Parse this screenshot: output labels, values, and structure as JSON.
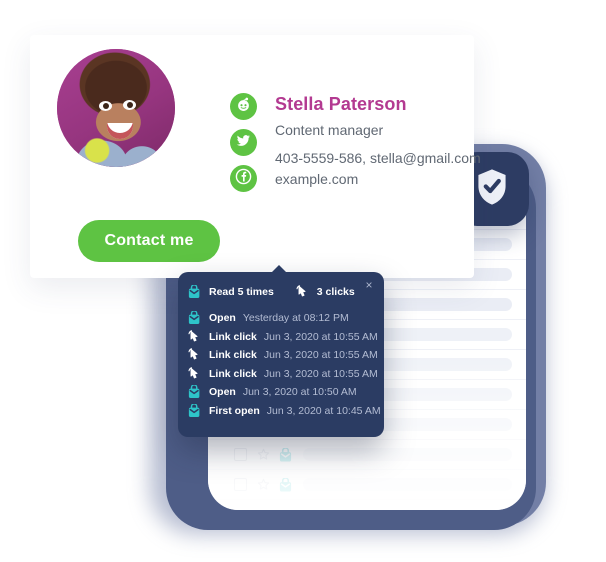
{
  "theme": {
    "brand_green": "#5ec343",
    "name_magenta": "#b33a91",
    "tooltip_navy": "#2b3c63",
    "accent_teal": "#2ec4c9",
    "card_slate": "#4e5d87"
  },
  "profile": {
    "avatar_alt": "Stella Paterson profile photo",
    "name": "Stella Paterson",
    "role": "Content manager",
    "contact_line1": "403-5559-586, stella@gmail.com",
    "contact_line2": "example.com",
    "contact_button": "Contact me",
    "socials": [
      {
        "name": "reddit",
        "icon": "reddit-icon"
      },
      {
        "name": "twitter",
        "icon": "twitter-icon"
      },
      {
        "name": "facebook",
        "icon": "facebook-icon"
      }
    ]
  },
  "badge": {
    "icon": "shield-check-icon"
  },
  "mail_list": {
    "rows": [
      {
        "checkbox_icon": "checkbox-icon",
        "star_icon": "star-icon",
        "tracking_icon": "tracked-envelope-icon"
      },
      {
        "checkbox_icon": "checkbox-icon",
        "star_icon": "star-icon",
        "tracking_icon": "tracked-envelope-icon"
      },
      {
        "checkbox_icon": "checkbox-icon",
        "star_icon": "star-icon",
        "tracking_icon": "tracked-envelope-icon"
      },
      {
        "checkbox_icon": "checkbox-icon",
        "star_icon": "star-icon",
        "tracking_icon": "tracked-envelope-icon"
      },
      {
        "checkbox_icon": "checkbox-icon",
        "star_icon": "star-icon",
        "tracking_icon": "tracked-envelope-icon"
      },
      {
        "checkbox_icon": "checkbox-icon",
        "star_icon": "star-icon",
        "tracking_icon": "tracked-envelope-icon"
      },
      {
        "checkbox_icon": "checkbox-icon",
        "star_icon": "star-icon",
        "tracking_icon": "tracked-envelope-icon"
      },
      {
        "checkbox_icon": "checkbox-icon",
        "star_icon": "star-icon",
        "tracking_icon": "tracked-envelope-icon"
      },
      {
        "checkbox_icon": "checkbox-icon",
        "star_icon": "star-icon",
        "tracking_icon": "tracked-envelope-icon"
      },
      {
        "checkbox_icon": "checkbox-icon",
        "star_icon": "star-icon",
        "tracking_icon": "tracked-envelope-icon"
      },
      {
        "checkbox_icon": "checkbox-icon",
        "star_icon": "star-icon",
        "tracking_icon": "tracked-envelope-icon"
      }
    ]
  },
  "tooltip": {
    "close_label": "×",
    "summary": {
      "reads_icon": "opened-envelope-icon",
      "reads_label": "Read 5 times",
      "clicks_icon": "cursor-click-icon",
      "clicks_label": "3 clicks"
    },
    "events": [
      {
        "icon": "opened-envelope-icon",
        "label": "Open",
        "when": "Yesterday at 08:12 PM"
      },
      {
        "icon": "cursor-click-icon",
        "label": "Link click",
        "when": "Jun 3, 2020 at 10:55 AM"
      },
      {
        "icon": "cursor-click-icon",
        "label": "Link click",
        "when": "Jun 3, 2020 at 10:55 AM"
      },
      {
        "icon": "cursor-click-icon",
        "label": "Link click",
        "when": "Jun 3, 2020 at 10:55 AM"
      },
      {
        "icon": "opened-envelope-icon",
        "label": "Open",
        "when": "Jun 3, 2020 at 10:50 AM"
      },
      {
        "icon": "opened-envelope-icon",
        "label": "First open",
        "when": "Jun 3, 2020 at 10:45 AM"
      }
    ]
  }
}
